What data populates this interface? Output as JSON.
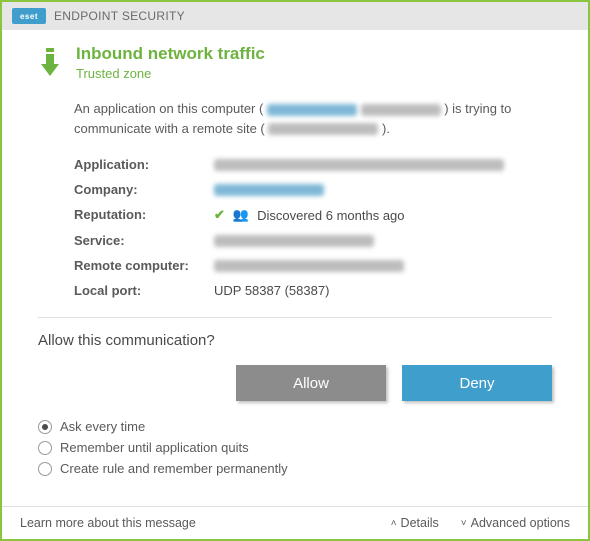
{
  "titlebar": {
    "logo_text": "eset",
    "product": "ENDPOINT SECURITY"
  },
  "header": {
    "title": "Inbound network traffic",
    "subtitle": "Trusted zone"
  },
  "description": {
    "pre": "An application on this computer (",
    "mid": ") is trying to communicate with a remote site (",
    "post": ")."
  },
  "details": {
    "labels": {
      "application": "Application:",
      "company": "Company:",
      "reputation": "Reputation:",
      "service": "Service:",
      "remote": "Remote computer:",
      "localport": "Local port:"
    },
    "reputation_text": "Discovered 6 months ago",
    "localport_value": "UDP 58387 (58387)"
  },
  "question": "Allow this communication?",
  "buttons": {
    "allow": "Allow",
    "deny": "Deny"
  },
  "radios": {
    "every": "Ask every time",
    "remember_quit": "Remember until application quits",
    "create_rule": "Create rule and remember permanently",
    "selected": "every"
  },
  "footer": {
    "learn": "Learn more about this message",
    "details": "Details",
    "advanced": "Advanced options"
  }
}
